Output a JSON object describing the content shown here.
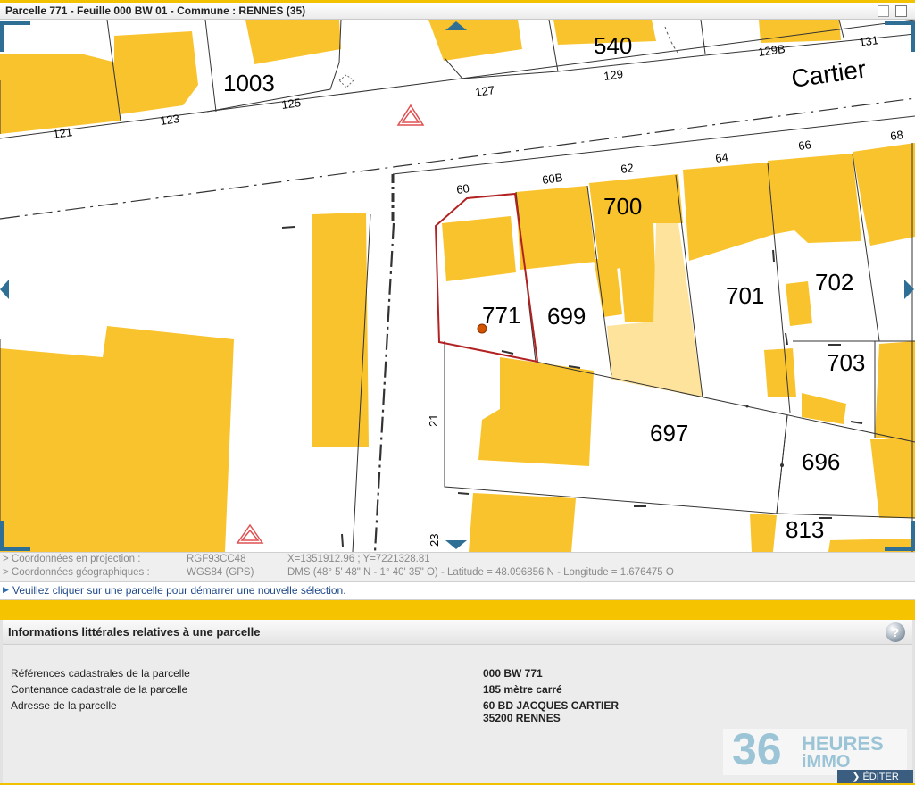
{
  "window": {
    "title": "Parcelle 771 - Feuille 000 BW 01 - Commune : RENNES (35)"
  },
  "map": {
    "street_name": "Cartier",
    "labels": [
      "1003",
      "540",
      "700",
      "771",
      "699",
      "701",
      "702",
      "703",
      "697",
      "696",
      "813"
    ],
    "numbers": [
      "121",
      "123",
      "125",
      "127",
      "129",
      "129B",
      "131",
      "60",
      "60B",
      "62",
      "64",
      "66",
      "68",
      "21",
      "23"
    ],
    "colors": {
      "building": "#f9c32d",
      "light_building": "#fde39c",
      "selected_parcel": "#b22222"
    }
  },
  "coordinates": {
    "proj_label": "> Coordonnées en projection :",
    "proj_system": "RGF93CC48",
    "proj_values": "X=1351912.96 ; Y=7221328.81",
    "geo_label": "> Coordonnées géographiques :",
    "geo_system": "WGS84 (GPS)",
    "geo_values": "DMS (48° 5' 48\" N - 1° 40' 35\" O) - Latitude = 48.096856 N - Longitude = 1.676475 O"
  },
  "hint": "Veuillez cliquer sur une parcelle pour démarrer une nouvelle sélection.",
  "panel": {
    "title": "Informations littérales relatives à une parcelle",
    "rows": [
      {
        "label": "Références cadastrales de la parcelle",
        "value": "000 BW 771"
      },
      {
        "label": "Contenance cadastrale de la parcelle",
        "value": "185 mètre carré"
      },
      {
        "label": "Adresse de la parcelle",
        "value": "60 BD JACQUES CARTIER",
        "value2": "35200 RENNES"
      }
    ],
    "help": "?"
  },
  "logo": {
    "number": "36",
    "word1": "HEURES",
    "word2": "iMMO"
  },
  "edit_button": "ÉDITER"
}
